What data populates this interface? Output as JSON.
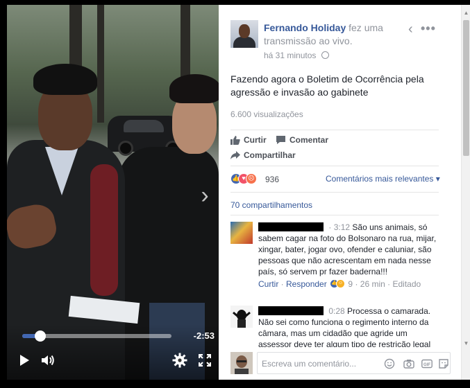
{
  "window": {
    "close_label": "×"
  },
  "video": {
    "time_remaining": "-2:53",
    "progress_fraction": 0.12,
    "next_glyph": "›"
  },
  "post": {
    "author": "Fernando Holiday",
    "action_text": " fez uma transmissão ao vivo.",
    "time_ago": "há 31 minutos",
    "back_glyph": "‹",
    "more_glyph": "•••",
    "text": "Fazendo agora o Boletim de Ocorrência pela agressão e invasão ao gabinete",
    "views": "6.600 visualizações"
  },
  "actions": {
    "like": "Curtir",
    "comment": "Comentar",
    "share": "Compartilhar"
  },
  "reactions": {
    "count": "936",
    "sort_label": "Comentários mais relevantes ▾",
    "shares": "70 compartilhamentos"
  },
  "comments": [
    {
      "time": "3:12",
      "text": "São uns animais, só sabem cagar na foto do Bolsonaro na rua, mijar, xingar, bater, jogar ovo, ofender e caluniar, são pessoas que não acrescentam em nada nesse país, só servem pr fazer baderna!!!",
      "like_label": "Curtir",
      "reply_label": "Responder",
      "reaction_count": "9",
      "ago": "26 min",
      "edited": "Editado"
    },
    {
      "time": "0:28",
      "text": "Processa o camarada. Não sei como funciona o regimento interno da câmara, mas um cidadão que agride um assessor deve ter algum tipo de restrição legal"
    }
  ],
  "composer": {
    "placeholder": "Escreva um comentário..."
  },
  "colors": {
    "link": "#365899",
    "like_blue": "#4267b2",
    "angry": "#f7714c",
    "haha": "#f7b125"
  }
}
